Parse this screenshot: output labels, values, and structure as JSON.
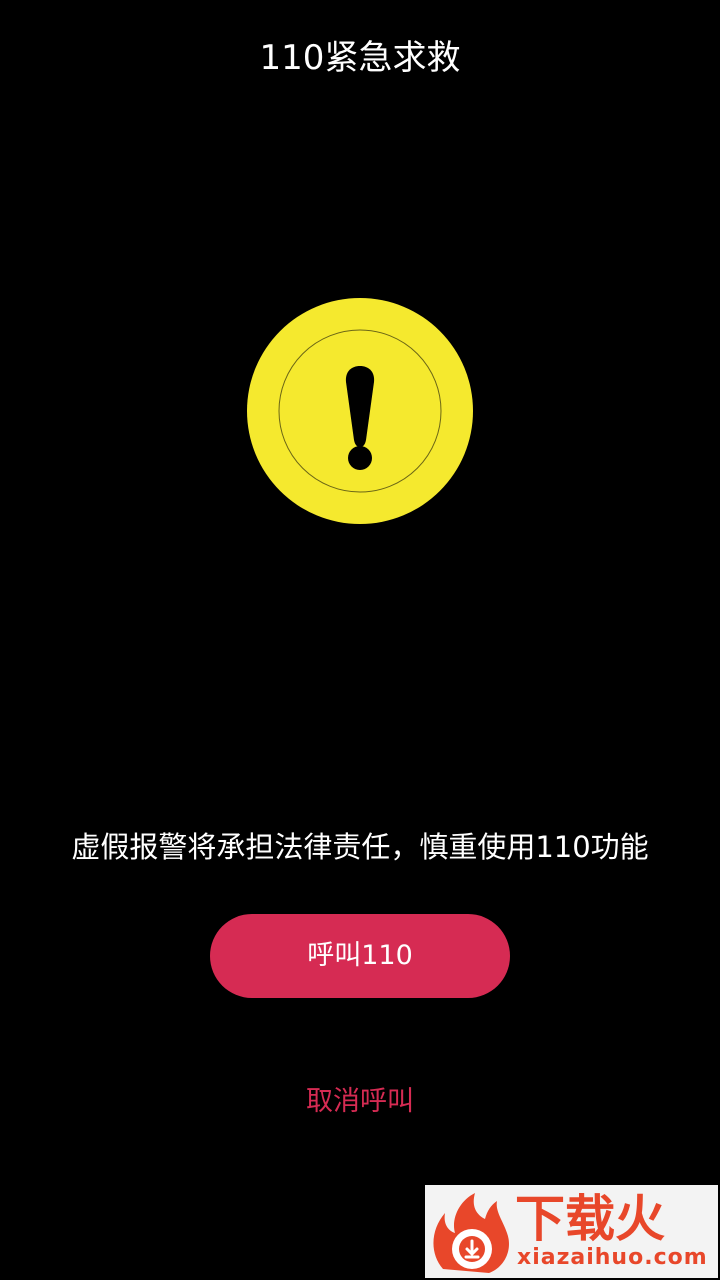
{
  "header": {
    "title": "110紧急求救"
  },
  "warning": {
    "icon": "exclamation-warning-icon",
    "badge_color": "#f5e92e",
    "mark_color": "#000000"
  },
  "notice": {
    "text": "虚假报警将承担法律责任，慎重使用110功能"
  },
  "actions": {
    "call_label": "呼叫110",
    "call_color": "#d62b53",
    "cancel_label": "取消呼叫",
    "cancel_color": "#d62b53"
  },
  "watermark": {
    "logo": "flame-download-logo",
    "name": "下载火",
    "domain": "xiazaihuo.com",
    "color": "#e8472a"
  }
}
